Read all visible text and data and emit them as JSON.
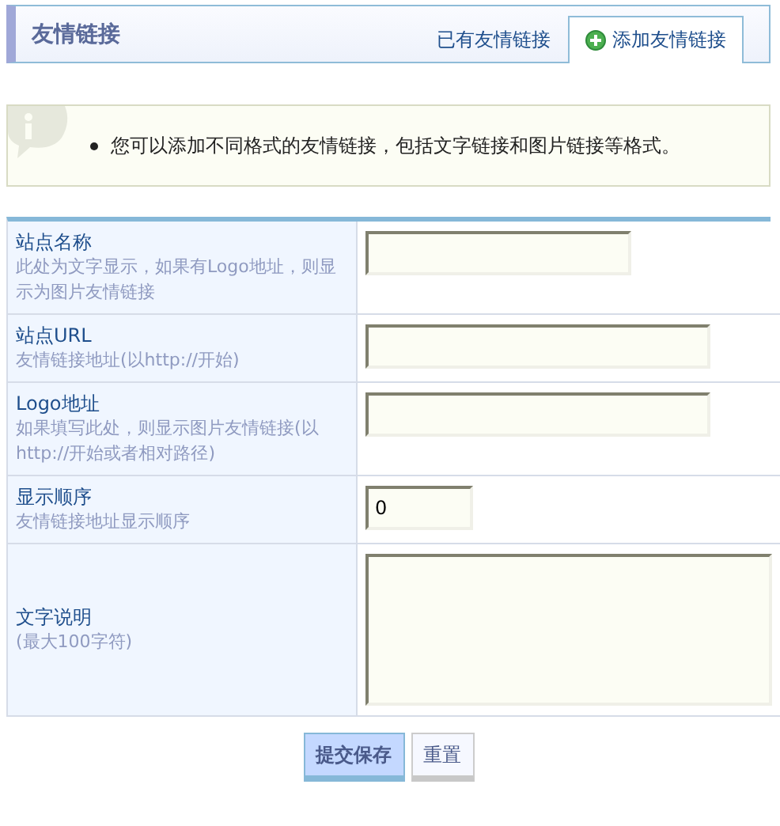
{
  "header": {
    "title": "友情链接"
  },
  "tabs": [
    {
      "label": "已有友情链接",
      "selected": false
    },
    {
      "label": "添加友情链接",
      "selected": true
    }
  ],
  "notice": {
    "items": [
      "您可以添加不同格式的友情链接，包括文字链接和图片链接等格式。"
    ]
  },
  "fields": [
    {
      "label": "站点名称",
      "hint": "此处为文字显示，如果有Logo地址，则显示为图片友情链接",
      "kind": "medium"
    },
    {
      "label": "站点URL",
      "hint": "友情链接地址(以http://开始)",
      "kind": "long"
    },
    {
      "label": "Logo地址",
      "hint": "如果填写此处，则显示图片友情链接(以http://开始或者相对路径)",
      "kind": "long"
    },
    {
      "label": "显示顺序",
      "hint": "友情链接地址显示顺序",
      "kind": "short",
      "value": "0"
    },
    {
      "label": "文字说明",
      "hint": "(最大100字符)",
      "kind": "textarea"
    }
  ],
  "buttons": [
    {
      "label": "提交保存",
      "kind": "primary"
    },
    {
      "label": "重置",
      "kind": "secondary"
    }
  ]
}
